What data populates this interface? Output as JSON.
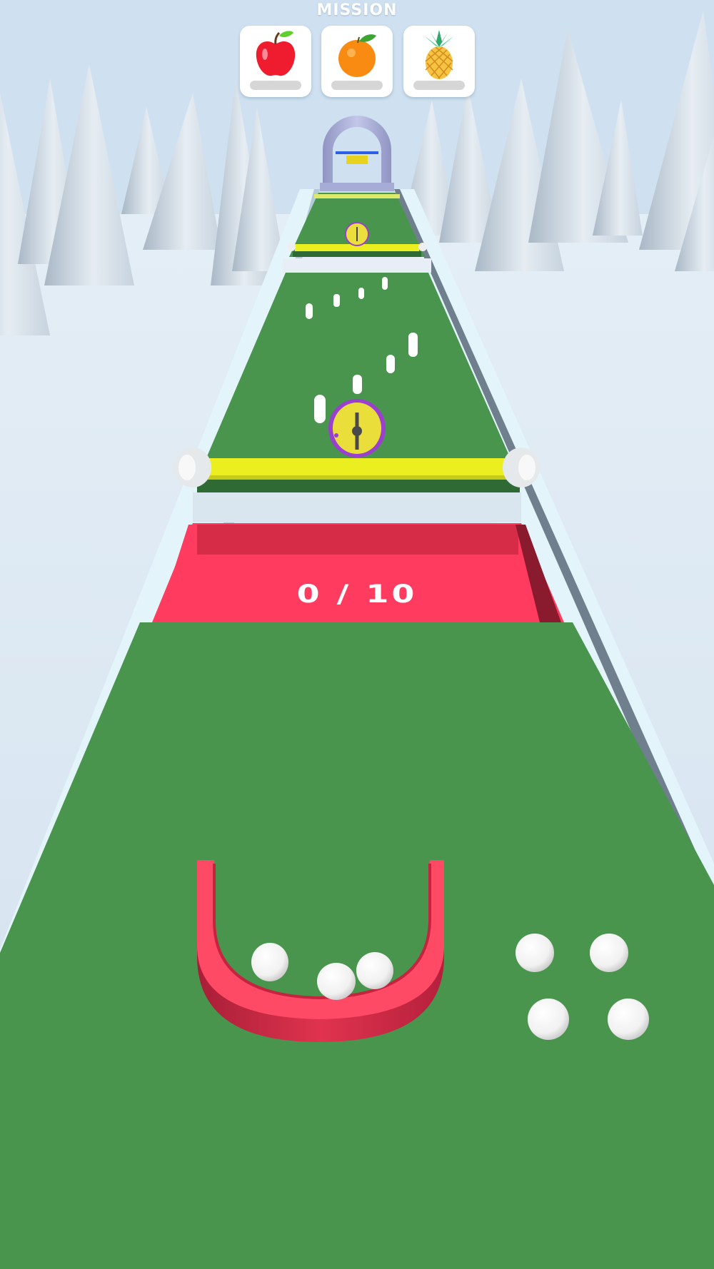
{
  "hud": {
    "mission_label": "MISSION",
    "missions": [
      {
        "item": "apple",
        "icon": "apple-icon"
      },
      {
        "item": "orange",
        "icon": "orange-icon"
      },
      {
        "item": "pineapple",
        "icon": "pineapple-icon"
      }
    ]
  },
  "track": {
    "collector_counter": "0 / 10"
  },
  "colors": {
    "sky": "#cfe1f1",
    "track_green": "#4a954e",
    "gate_yellow": "#ecef1f",
    "collector_red": "#ff3c5f",
    "ball_white": "#ffffff"
  }
}
